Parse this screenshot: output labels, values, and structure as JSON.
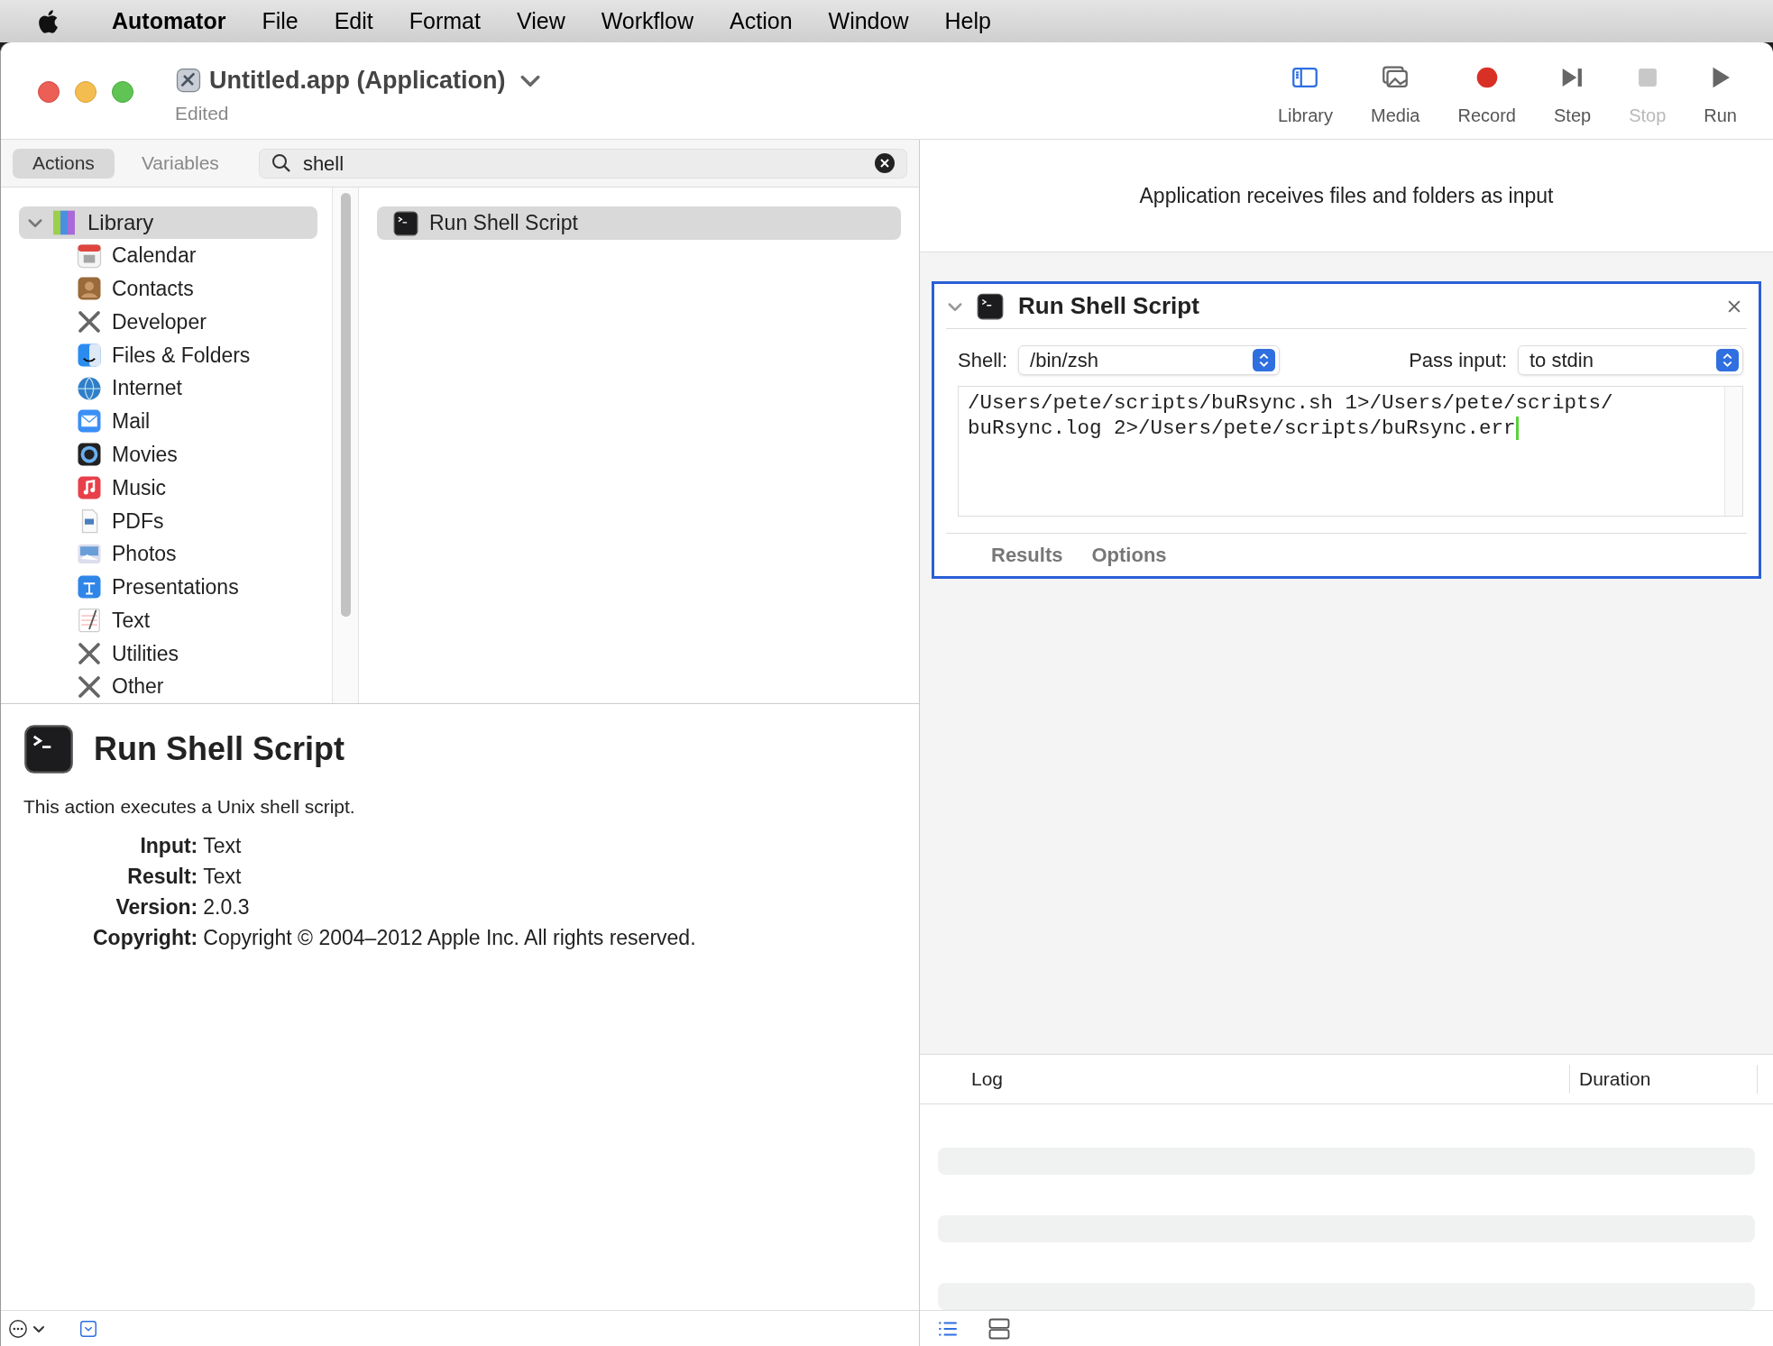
{
  "menu_bar": {
    "app": "Automator",
    "items": [
      "File",
      "Edit",
      "Format",
      "View",
      "Workflow",
      "Action",
      "Window",
      "Help"
    ]
  },
  "window": {
    "title": "Untitled.app (Application)",
    "subtitle": "Edited"
  },
  "toolbar": [
    {
      "label": "Library",
      "selected": true,
      "disabled": false
    },
    {
      "label": "Media",
      "selected": false,
      "disabled": false
    },
    {
      "label": "Record",
      "selected": false,
      "disabled": false
    },
    {
      "label": "Step",
      "selected": false,
      "disabled": false
    },
    {
      "label": "Stop",
      "selected": false,
      "disabled": true
    },
    {
      "label": "Run",
      "selected": false,
      "disabled": false
    }
  ],
  "library_tabs": [
    {
      "label": "Actions",
      "selected": true
    },
    {
      "label": "Variables",
      "selected": false
    }
  ],
  "search": {
    "value": "shell"
  },
  "library": {
    "label": "Library",
    "expanded": true,
    "selected": true,
    "children": [
      {
        "label": "Calendar"
      },
      {
        "label": "Contacts"
      },
      {
        "label": "Developer"
      },
      {
        "label": "Files & Folders"
      },
      {
        "label": "Internet"
      },
      {
        "label": "Mail"
      },
      {
        "label": "Movies"
      },
      {
        "label": "Music"
      },
      {
        "label": "PDFs"
      },
      {
        "label": "Photos"
      },
      {
        "label": "Presentations"
      },
      {
        "label": "Text"
      },
      {
        "label": "Utilities"
      },
      {
        "label": "Other"
      }
    ]
  },
  "actions_list": [
    {
      "label": "Run Shell Script",
      "selected": true
    }
  ],
  "description": {
    "title": "Run Shell Script",
    "summary": "This action executes a Unix shell script.",
    "fields": [
      {
        "label": "Input:",
        "value": "Text"
      },
      {
        "label": "Result:",
        "value": "Text"
      },
      {
        "label": "Version:",
        "value": "2.0.3"
      },
      {
        "label": "Copyright:",
        "value": "Copyright © 2004–2012 Apple Inc.  All rights reserved."
      }
    ]
  },
  "workflow": {
    "input_note": "Application receives files and folders as input",
    "action": {
      "title": "Run Shell Script",
      "selected": true,
      "expanded": true,
      "shell_label": "Shell:",
      "shell": "/bin/zsh",
      "pass_label": "Pass input:",
      "pass": "to stdin",
      "script": "/Users/pete/scripts/buRsync.sh 1>/Users/pete/scripts/buRsync.log 2>/Users/pete/scripts/buRsync.err",
      "tabs": [
        "Results",
        "Options"
      ]
    }
  },
  "log": {
    "columns": [
      "Log",
      "Duration"
    ]
  }
}
